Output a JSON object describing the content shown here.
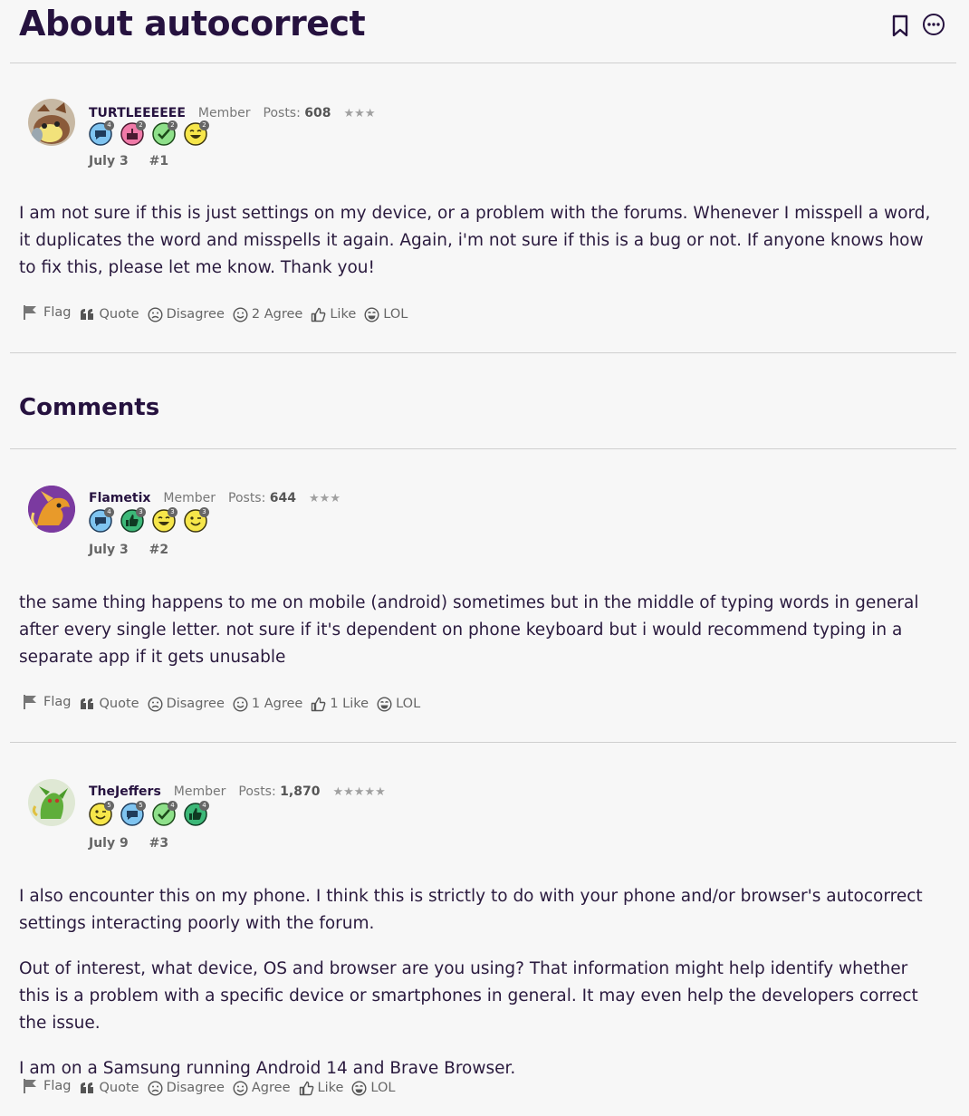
{
  "thread": {
    "title": "About autocorrect",
    "bookmark_icon": "bookmark-icon",
    "more_icon": "more-options-icon"
  },
  "comments_heading": "Comments",
  "posts": [
    {
      "username": "TURTLEEEEEE",
      "role": "Member",
      "posts_label": "Posts:",
      "posts_count": "608",
      "stars": "★★★",
      "date": "July 3",
      "number": "#1",
      "badges": [
        {
          "icon": "comment-badge-icon",
          "count": "4"
        },
        {
          "icon": "cake-badge-icon",
          "count": "2"
        },
        {
          "icon": "check-badge-icon",
          "count": "2"
        },
        {
          "icon": "laugh-badge-icon",
          "count": "2"
        }
      ],
      "paragraphs": [
        "I am not sure if this is just settings on my device, or a problem with the forums. Whenever I misspell a word, it duplicates the word and misspells it again. Again, i'm not sure if this is a bug or not. If anyone knows how to fix this, please let me know. Thank you!"
      ],
      "actions": {
        "flag": "Flag",
        "quote": "Quote",
        "disagree": "Disagree",
        "agree": "2 Agree",
        "like": "Like",
        "lol": "LOL"
      }
    },
    {
      "username": "Flametix",
      "role": "Member",
      "posts_label": "Posts:",
      "posts_count": "644",
      "stars": "★★★",
      "date": "July 3",
      "number": "#2",
      "badges": [
        {
          "icon": "comment-badge-icon",
          "count": "4"
        },
        {
          "icon": "thumbs-up-badge-icon",
          "count": "3"
        },
        {
          "icon": "laugh-badge-icon",
          "count": "3"
        },
        {
          "icon": "wink-badge-icon",
          "count": "3"
        }
      ],
      "paragraphs": [
        "the same thing happens to me on mobile (android) sometimes but in the middle of typing words in general after every single letter. not sure if it's dependent on phone keyboard but i would recommend typing in a separate app if it gets unusable"
      ],
      "actions": {
        "flag": "Flag",
        "quote": "Quote",
        "disagree": "Disagree",
        "agree": "1 Agree",
        "like": "1 Like",
        "lol": "LOL"
      }
    },
    {
      "username": "TheJeffers",
      "role": "Member",
      "posts_label": "Posts:",
      "posts_count": "1,870",
      "stars": "★★★★★",
      "date": "July 9",
      "number": "#3",
      "badges": [
        {
          "icon": "wink-badge-icon",
          "count": "5"
        },
        {
          "icon": "comment-badge-icon",
          "count": "5"
        },
        {
          "icon": "check-badge-icon",
          "count": "4"
        },
        {
          "icon": "thumbs-up-badge-icon",
          "count": "4"
        }
      ],
      "paragraphs": [
        "I also encounter this on my phone. I think this is strictly to do with your phone and/or browser's autocorrect settings interacting poorly with the forum.",
        "Out of interest, what device, OS and browser are you using? That information might help identify whether this is a problem with a specific device or smartphones in general. It may even help the developers correct the issue.",
        "I am on a Samsung running Android 14 and Brave Browser."
      ],
      "actions": {
        "flag": "Flag",
        "quote": "Quote",
        "disagree": "Disagree",
        "agree": "Agree",
        "like": "Like",
        "lol": "LOL"
      }
    }
  ]
}
